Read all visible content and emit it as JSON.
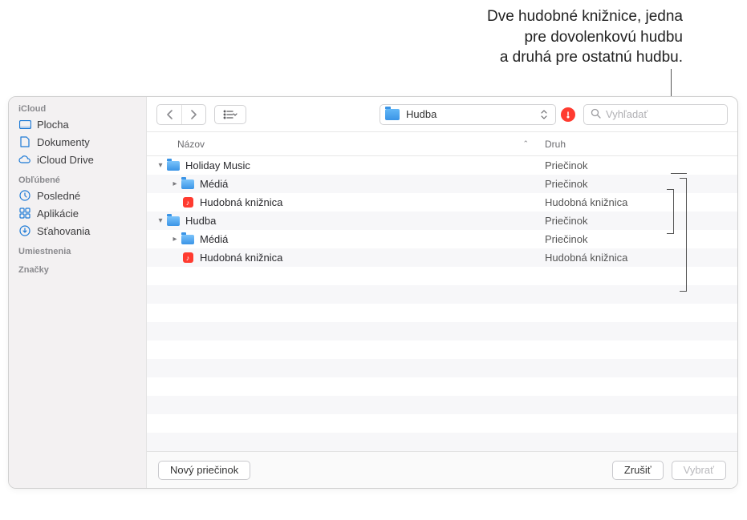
{
  "annotation": {
    "line1": "Dve hudobné knižnice, jedna",
    "line2": "pre dovolenkovú hudbu",
    "line3": "a druhá pre ostatnú hudbu."
  },
  "sidebar": {
    "sections": [
      {
        "title": "iCloud",
        "items": [
          {
            "icon": "desktop",
            "label": "Plocha"
          },
          {
            "icon": "doc",
            "label": "Dokumenty"
          },
          {
            "icon": "cloud",
            "label": "iCloud Drive"
          }
        ]
      },
      {
        "title": "Obľúbené",
        "items": [
          {
            "icon": "clock",
            "label": "Posledné"
          },
          {
            "icon": "apps",
            "label": "Aplikácie"
          },
          {
            "icon": "download",
            "label": "Sťahovania"
          }
        ]
      },
      {
        "title": "Umiestnenia",
        "items": []
      },
      {
        "title": "Značky",
        "items": []
      }
    ]
  },
  "toolbar": {
    "location_label": "Hudba",
    "search_placeholder": "Vyhľadať"
  },
  "columns": {
    "name": "Názov",
    "kind": "Druh"
  },
  "rows": [
    {
      "indent": 0,
      "disclosure": "open",
      "icon": "folder",
      "name": "Holiday Music",
      "kind": "Priečinok"
    },
    {
      "indent": 1,
      "disclosure": "closed",
      "icon": "folder",
      "name": "Médiá",
      "kind": "Priečinok"
    },
    {
      "indent": 1,
      "disclosure": "none",
      "icon": "library",
      "name": "Hudobná knižnica",
      "kind": "Hudobná knižnica"
    },
    {
      "indent": 0,
      "disclosure": "open",
      "icon": "folder",
      "name": "Hudba",
      "kind": "Priečinok"
    },
    {
      "indent": 1,
      "disclosure": "closed",
      "icon": "folder",
      "name": "Médiá",
      "kind": "Priečinok"
    },
    {
      "indent": 1,
      "disclosure": "none",
      "icon": "library",
      "name": "Hudobná knižnica",
      "kind": "Hudobná knižnica"
    }
  ],
  "buttons": {
    "new_folder": "Nový priečinok",
    "cancel": "Zrušiť",
    "choose": "Vybrať"
  }
}
